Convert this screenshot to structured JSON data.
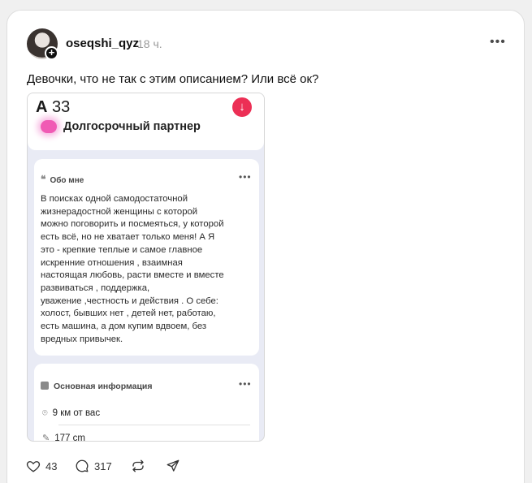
{
  "post": {
    "username": "oseqshi_qyz",
    "time": "18 ч.",
    "text": "Девочки, что не так с этим описанием? Или всё ок?"
  },
  "screenshot": {
    "top_letter": "А",
    "top_number": "33",
    "partner_label": "Долгосрочный партнер",
    "about_title": "Обо мне",
    "about_text": "В поисках одной самодостаточной\nжизнерадостной женщины с которой\nможно поговорить и посмеяться, у которой\nесть всё, но не хватает только меня!  А  Я\nэто - крепкие теплые  и самое главное\nискренние отношения , взаимная\nнастоящая любовь,  расти вместе и вместе\nразвиваться , поддержка,\nуважение ,честность и действия . О себе:\nхолост, бывших нет , детей нет, работаю,\nесть машина, а дом купим вдвоем, без\nвредных привычек.",
    "info_title": "Основная информация",
    "distance": "9 км от вас",
    "height": "177 cm"
  },
  "actions": {
    "likes": "43",
    "comments": "317"
  },
  "colors": {
    "accent_pink": "#ec2f55",
    "heart_glow": "#f05ab4"
  }
}
